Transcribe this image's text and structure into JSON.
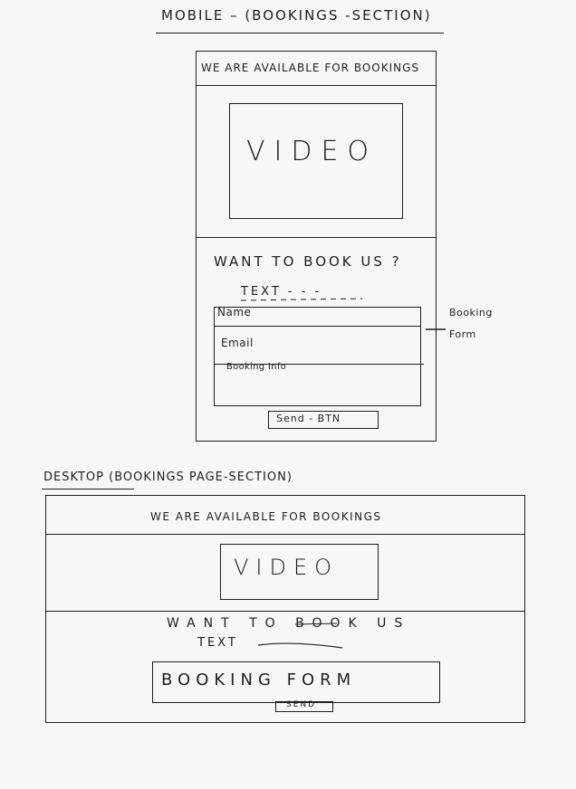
{
  "mobile": {
    "heading": "MOBILE – (BOOKINGS -SECTION)",
    "banner": "WE ARE AVAILABLE FOR BOOKINGS",
    "video": "VIDEO",
    "cta": "WANT TO BOOK US ?",
    "text": "TEXT - - -",
    "form": {
      "name_label": "Name",
      "email_label": "Email",
      "info_label": "Booking Info"
    },
    "send_button": "Send - BTN",
    "annotation": "Booking Form"
  },
  "desktop": {
    "heading": "DESKTOP (BOOKINGS PAGE-SECTION)",
    "banner": "WE ARE AVAILABLE FOR BOOKINGS",
    "video": "VIDEO",
    "cta": "WANT TO BOOK US",
    "text": "TEXT",
    "form": "BOOKING FORM",
    "send_button": "SEND"
  }
}
